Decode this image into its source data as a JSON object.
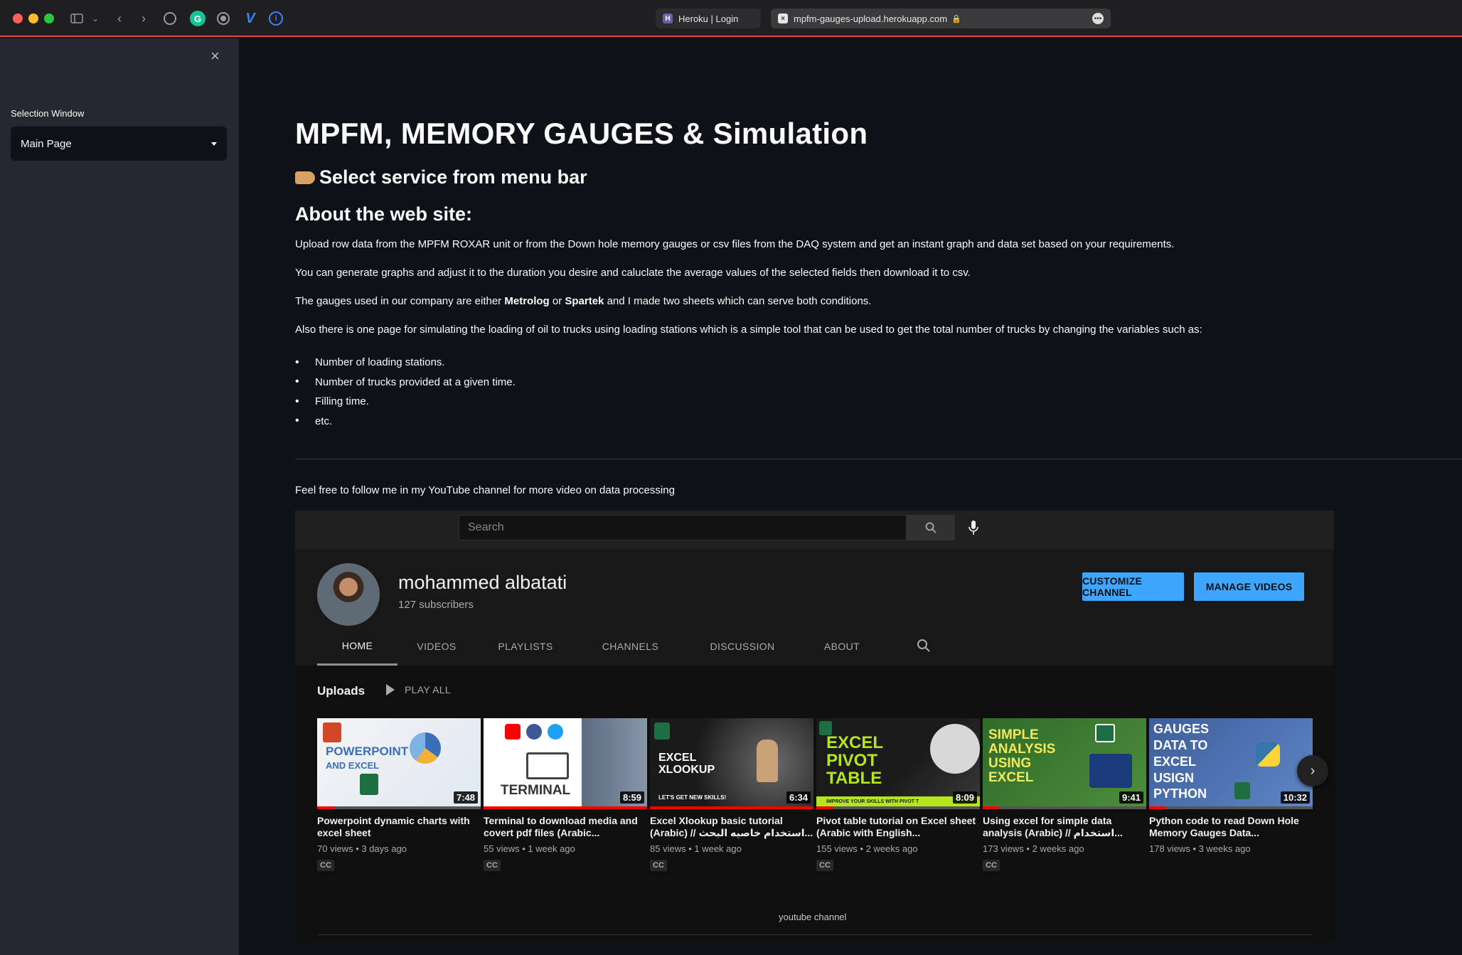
{
  "browser": {
    "tabs": [
      {
        "label": "Heroku | Login"
      },
      {
        "label": "mpfm-gauges-upload.herokuapp.com"
      }
    ]
  },
  "sidebar": {
    "close_glyph": "×",
    "select_label": "Selection Window",
    "select_value": "Main Page"
  },
  "main": {
    "title": "MPFM, MEMORY GAUGES & Simulation",
    "subhead": "Select service from menu bar",
    "about_heading": "About the web site:",
    "paragraphs": [
      "Upload row data from the MPFM ROXAR unit or from the Down hole memory gauges or csv files from the DAQ system and get an instant graph and data set based on your requirements.",
      "You can generate graphs and adjust it to the duration you desire and caluclate the average values of the selected fields then download it to csv.",
      "Also there is one page for simulating the loading of oil to trucks using loading stations which is a simple tool that can be used to get the total number of trucks by changing the variables such as:"
    ],
    "gauges_para": {
      "pre": "The gauges used in our company are either ",
      "b1": "Metrolog",
      "mid": " or ",
      "b2": "Spartek",
      "post": " and I made two sheets which can serve both conditions."
    },
    "bullets": [
      "Number of loading stations.",
      "Number of trucks provided at a given time.",
      "Filling time.",
      "etc."
    ],
    "follow_text": "Feel free to follow me in my YouTube channel for more video on data processing",
    "caption": "youtube channel"
  },
  "youtube": {
    "search_placeholder": "Search",
    "channel_name": "mohammed albatati",
    "subscribers": "127 subscribers",
    "customize_label": "CUSTOMIZE CHANNEL",
    "manage_label": "MANAGE VIDEOS",
    "tabs": [
      "HOME",
      "VIDEOS",
      "PLAYLISTS",
      "CHANNELS",
      "DISCUSSION",
      "ABOUT"
    ],
    "uploads_label": "Uploads",
    "play_all_label": "PLAY ALL",
    "videos": [
      {
        "title": "Powerpoint dynamic charts with excel sheet",
        "meta": "70 views • 3 days ago",
        "duration": "7:48",
        "cc": "CC",
        "progress": 0.1,
        "thumb_text": "POWERPOINT",
        "thumb_sub": "AND EXCEL"
      },
      {
        "title": "Terminal to download media and covert pdf files (Arabic...",
        "meta": "55 views • 1 week ago",
        "duration": "8:59",
        "cc": "CC",
        "progress": 1.0,
        "thumb_text": "TERMINAL"
      },
      {
        "title": "Excel Xlookup basic tutorial (Arabic) // استخدام خاصيه البحث...",
        "meta": "85 views • 1 week ago",
        "duration": "6:34",
        "cc": "CC",
        "progress": 1.0,
        "thumb_text": "EXCEL XLOOKUP",
        "thumb_sub": "LET'S GET NEW SKILLS!"
      },
      {
        "title": "Pivot table tutorial on Excel sheet (Arabic with English...",
        "meta": "155 views • 2 weeks ago",
        "duration": "8:09",
        "cc": "CC",
        "progress": 0.1,
        "thumb_text": "EXCEL PIVOT TABLE",
        "thumb_sub": "IMPROVE YOUR SKILLS WITH PIVOT T"
      },
      {
        "title": "Using excel for simple data analysis (Arabic) // استخدام...",
        "meta": "173 views • 2 weeks ago",
        "duration": "9:41",
        "cc": "CC",
        "progress": 0.1,
        "thumb_text": "SIMPLE ANALYSIS USING EXCEL"
      },
      {
        "title": "Python code to read Down Hole Memory Gauges Data...",
        "meta": "178 views • 3 weeks ago",
        "duration": "10:32",
        "cc": "",
        "progress": 0.1,
        "thumb_text": "GAUGES DATA TO EXCEL USIGN PYTHON"
      }
    ]
  },
  "colors": {
    "app_bg": "#0e1117",
    "sidebar_bg": "#262730",
    "yt_accent": "#3ea6ff",
    "yt_progress": "#ff0000"
  }
}
